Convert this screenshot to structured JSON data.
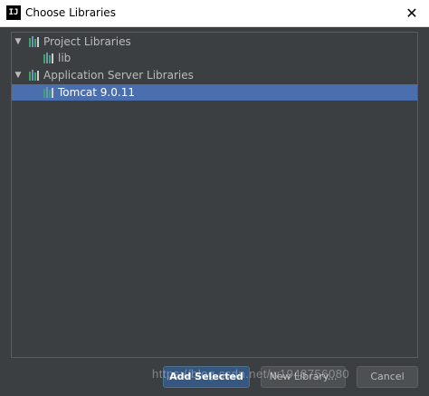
{
  "window": {
    "title": "Choose Libraries",
    "app_icon_label": "IJ",
    "close_glyph": "✕"
  },
  "tree": {
    "items": [
      {
        "label": "Project Libraries",
        "expanded": true,
        "level": 0,
        "toggle": "▼"
      },
      {
        "label": "lib",
        "level": 1
      },
      {
        "label": "Application Server Libraries",
        "expanded": true,
        "level": 0,
        "toggle": "▼"
      },
      {
        "label": "Tomcat 9.0.11",
        "level": 1,
        "selected": true
      }
    ]
  },
  "buttons": {
    "add_selected": "Add Selected",
    "new_library": "New Library...",
    "cancel": "Cancel"
  },
  "watermark": "https://blog.csdn.net/w1948756080",
  "colors": {
    "background": "#3c3f41",
    "selection": "#4b6eaf",
    "primary_button": "#365880",
    "library_icon_green": "#3fa36b"
  },
  "icons": {
    "library": "library-icon",
    "expand": "triangle-down-icon",
    "close": "close-icon"
  }
}
